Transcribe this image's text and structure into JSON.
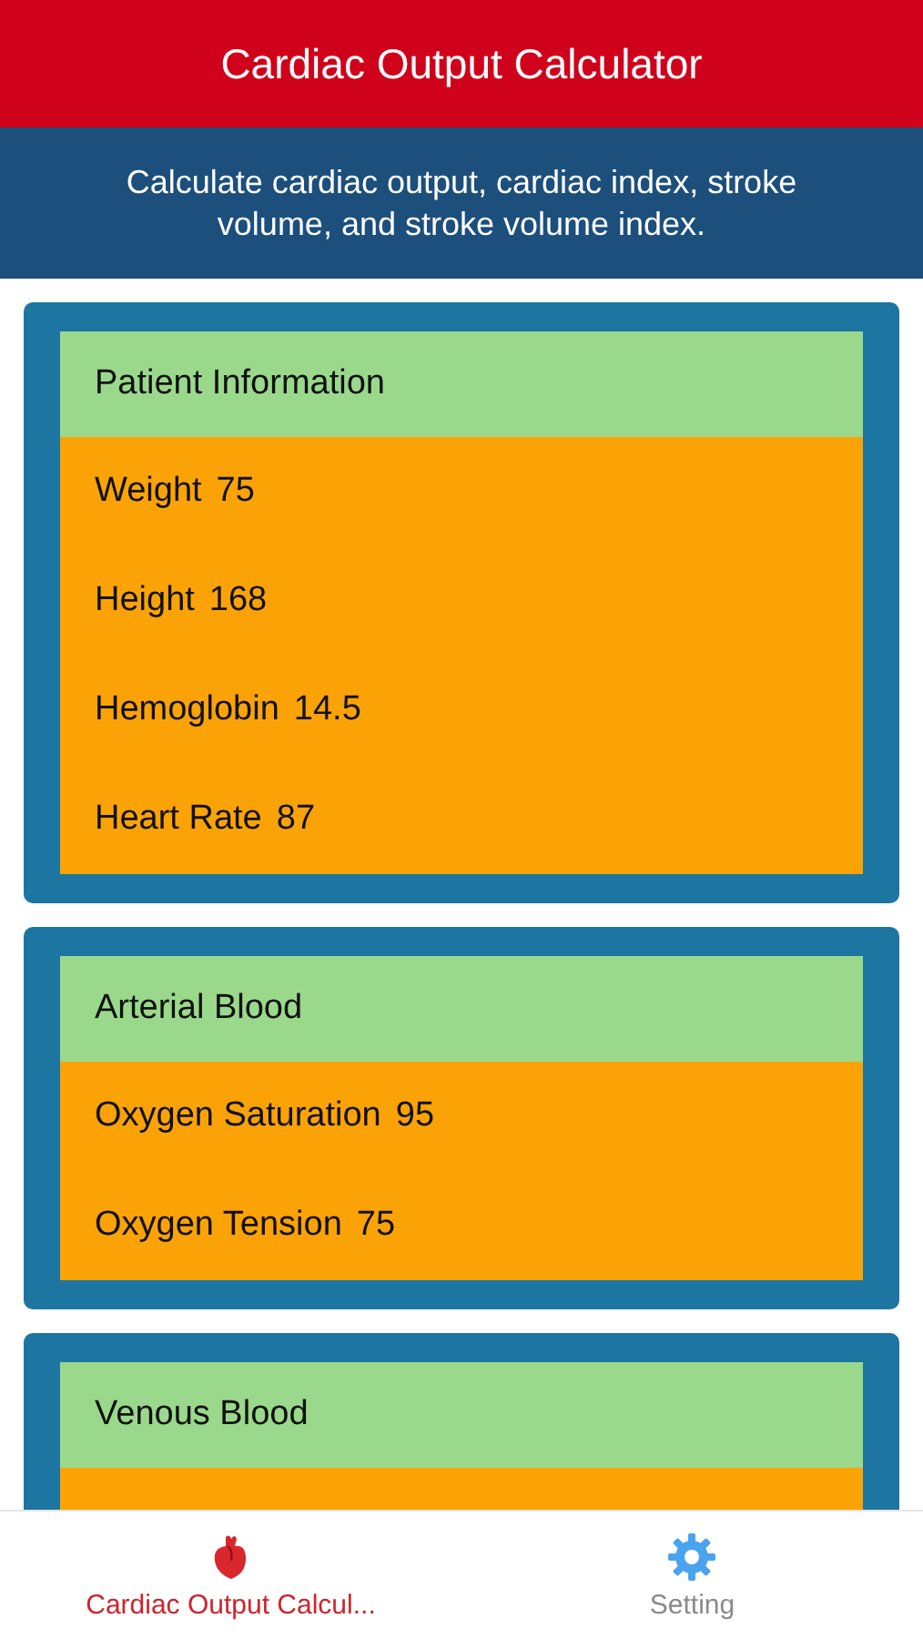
{
  "title": "Cardiac Output Calculator",
  "subtitle": "Calculate cardiac output, cardiac index, stroke volume, and stroke volume index.",
  "sections": [
    {
      "heading": "Patient Information",
      "fields": [
        {
          "label": "Weight",
          "value": "75"
        },
        {
          "label": "Height",
          "value": "168"
        },
        {
          "label": "Hemoglobin",
          "value": "14.5"
        },
        {
          "label": "Heart Rate",
          "value": "87"
        }
      ]
    },
    {
      "heading": "Arterial Blood",
      "fields": [
        {
          "label": "Oxygen Saturation",
          "value": "95"
        },
        {
          "label": "Oxygen Tension",
          "value": "75"
        }
      ]
    },
    {
      "heading": "Venous Blood"
    }
  ],
  "tab_bar": [
    {
      "kind": "heart",
      "label": "Cardiac Output Calcul...",
      "selected": true
    },
    {
      "kind": "gear",
      "label": "Setting",
      "selected": false
    }
  ]
}
